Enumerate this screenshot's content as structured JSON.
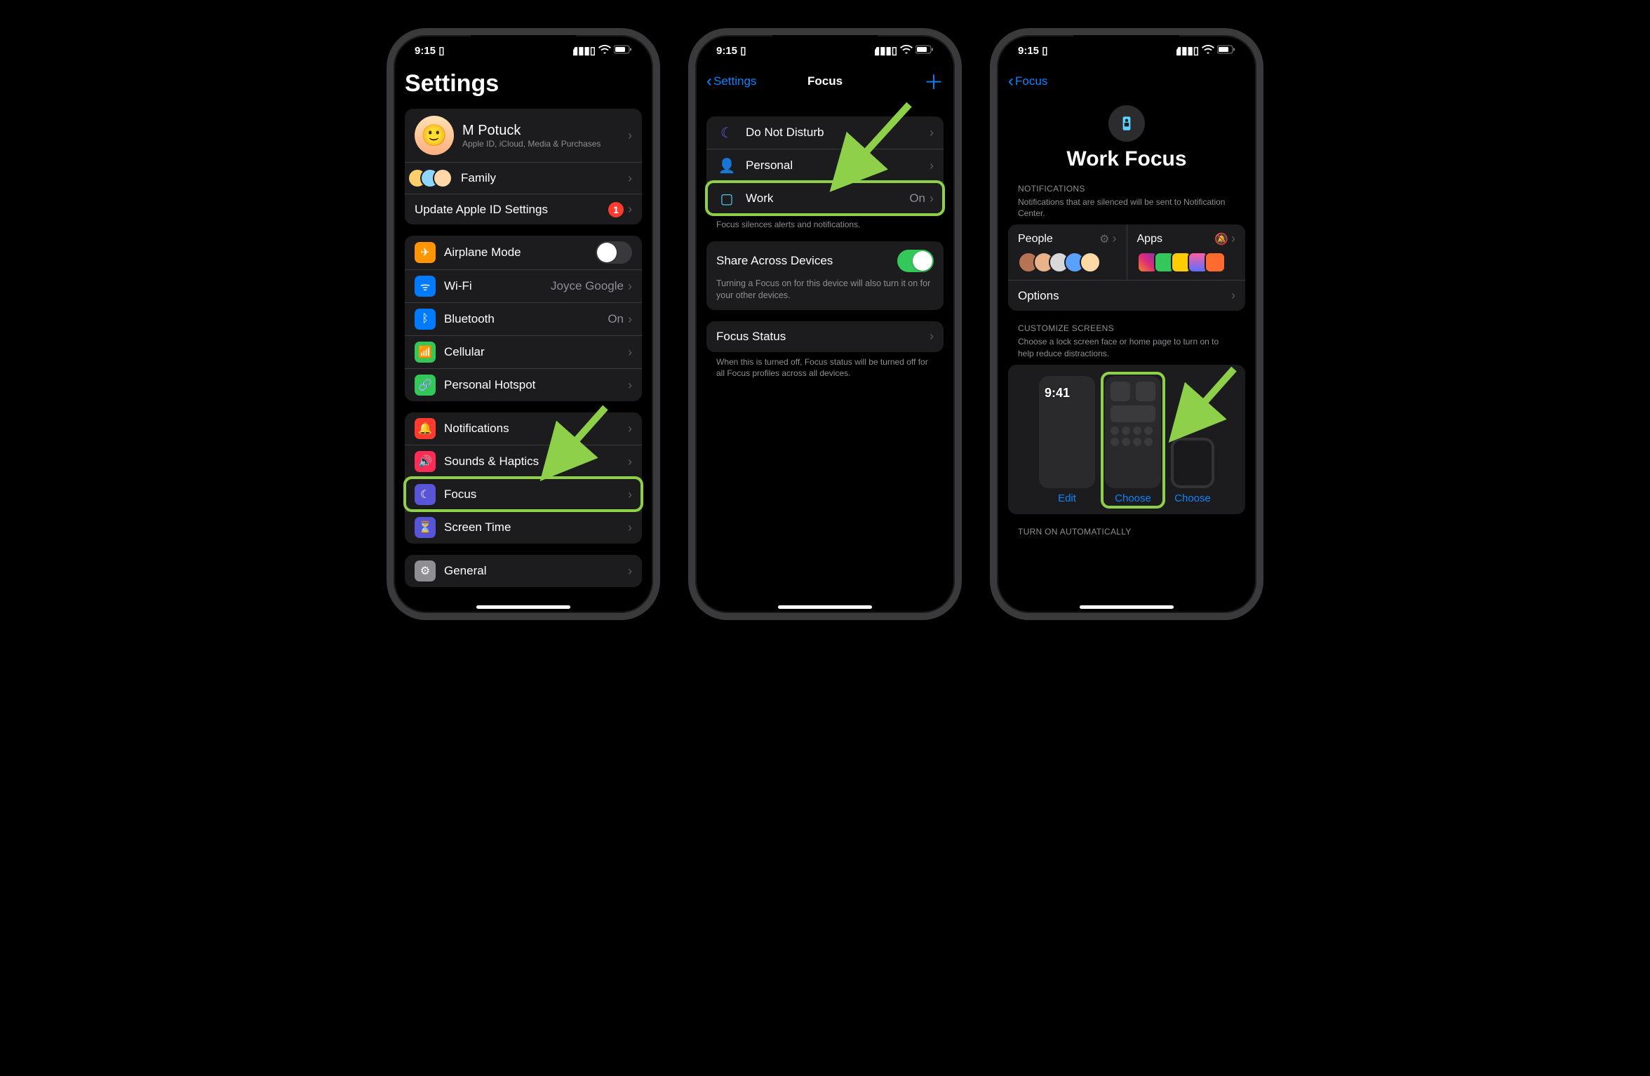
{
  "statusTime": "9:15",
  "statusExtra": "▯",
  "screen1": {
    "title": "Settings",
    "account": {
      "name": "M Potuck",
      "sub": "Apple ID, iCloud, Media & Purchases"
    },
    "family": "Family",
    "updateRow": "Update Apple ID Settings",
    "updateBadge": "1",
    "rows_net": [
      {
        "label": "Airplane Mode",
        "iconBg": "#ff9500",
        "toggle": false
      },
      {
        "label": "Wi-Fi",
        "iconBg": "#007aff",
        "detail": "Joyce Google"
      },
      {
        "label": "Bluetooth",
        "iconBg": "#007aff",
        "detail": "On"
      },
      {
        "label": "Cellular",
        "iconBg": "#34c759"
      },
      {
        "label": "Personal Hotspot",
        "iconBg": "#34c759"
      }
    ],
    "rows_notif": [
      {
        "label": "Notifications",
        "iconBg": "#ff3b30"
      },
      {
        "label": "Sounds & Haptics",
        "iconBg": "#ff2d55"
      },
      {
        "label": "Focus",
        "iconBg": "#5856d6"
      },
      {
        "label": "Screen Time",
        "iconBg": "#5856d6"
      }
    ],
    "rows_gen": [
      {
        "label": "General",
        "iconBg": "#8e8e93"
      }
    ]
  },
  "screen2": {
    "back": "Settings",
    "title": "Focus",
    "modes": [
      {
        "label": "Do Not Disturb",
        "iconColor": "#5e5ce6"
      },
      {
        "label": "Personal",
        "iconColor": "#af52de"
      },
      {
        "label": "Work",
        "iconColor": "#5ad3ff",
        "detail": "On"
      }
    ],
    "modesCaption": "Focus silences alerts and notifications.",
    "shareLabel": "Share Across Devices",
    "shareCaption": "Turning a Focus on for this device will also turn it on for your other devices.",
    "statusLabel": "Focus Status",
    "statusCaption": "When this is turned off, Focus status will be turned off for all Focus profiles across all devices."
  },
  "screen3": {
    "back": "Focus",
    "title": "Work Focus",
    "notifHeader": "NOTIFICATIONS",
    "notifCaption": "Notifications that are silenced will be sent to Notification Center.",
    "people": "People",
    "apps": "Apps",
    "options": "Options",
    "custHeader": "CUSTOMIZE SCREENS",
    "custCaption": "Choose a lock screen face or home page to turn on to help reduce distractions.",
    "edit": "Edit",
    "choose": "Choose",
    "autoHeader": "TURN ON AUTOMATICALLY",
    "lockTime": "9:41"
  }
}
